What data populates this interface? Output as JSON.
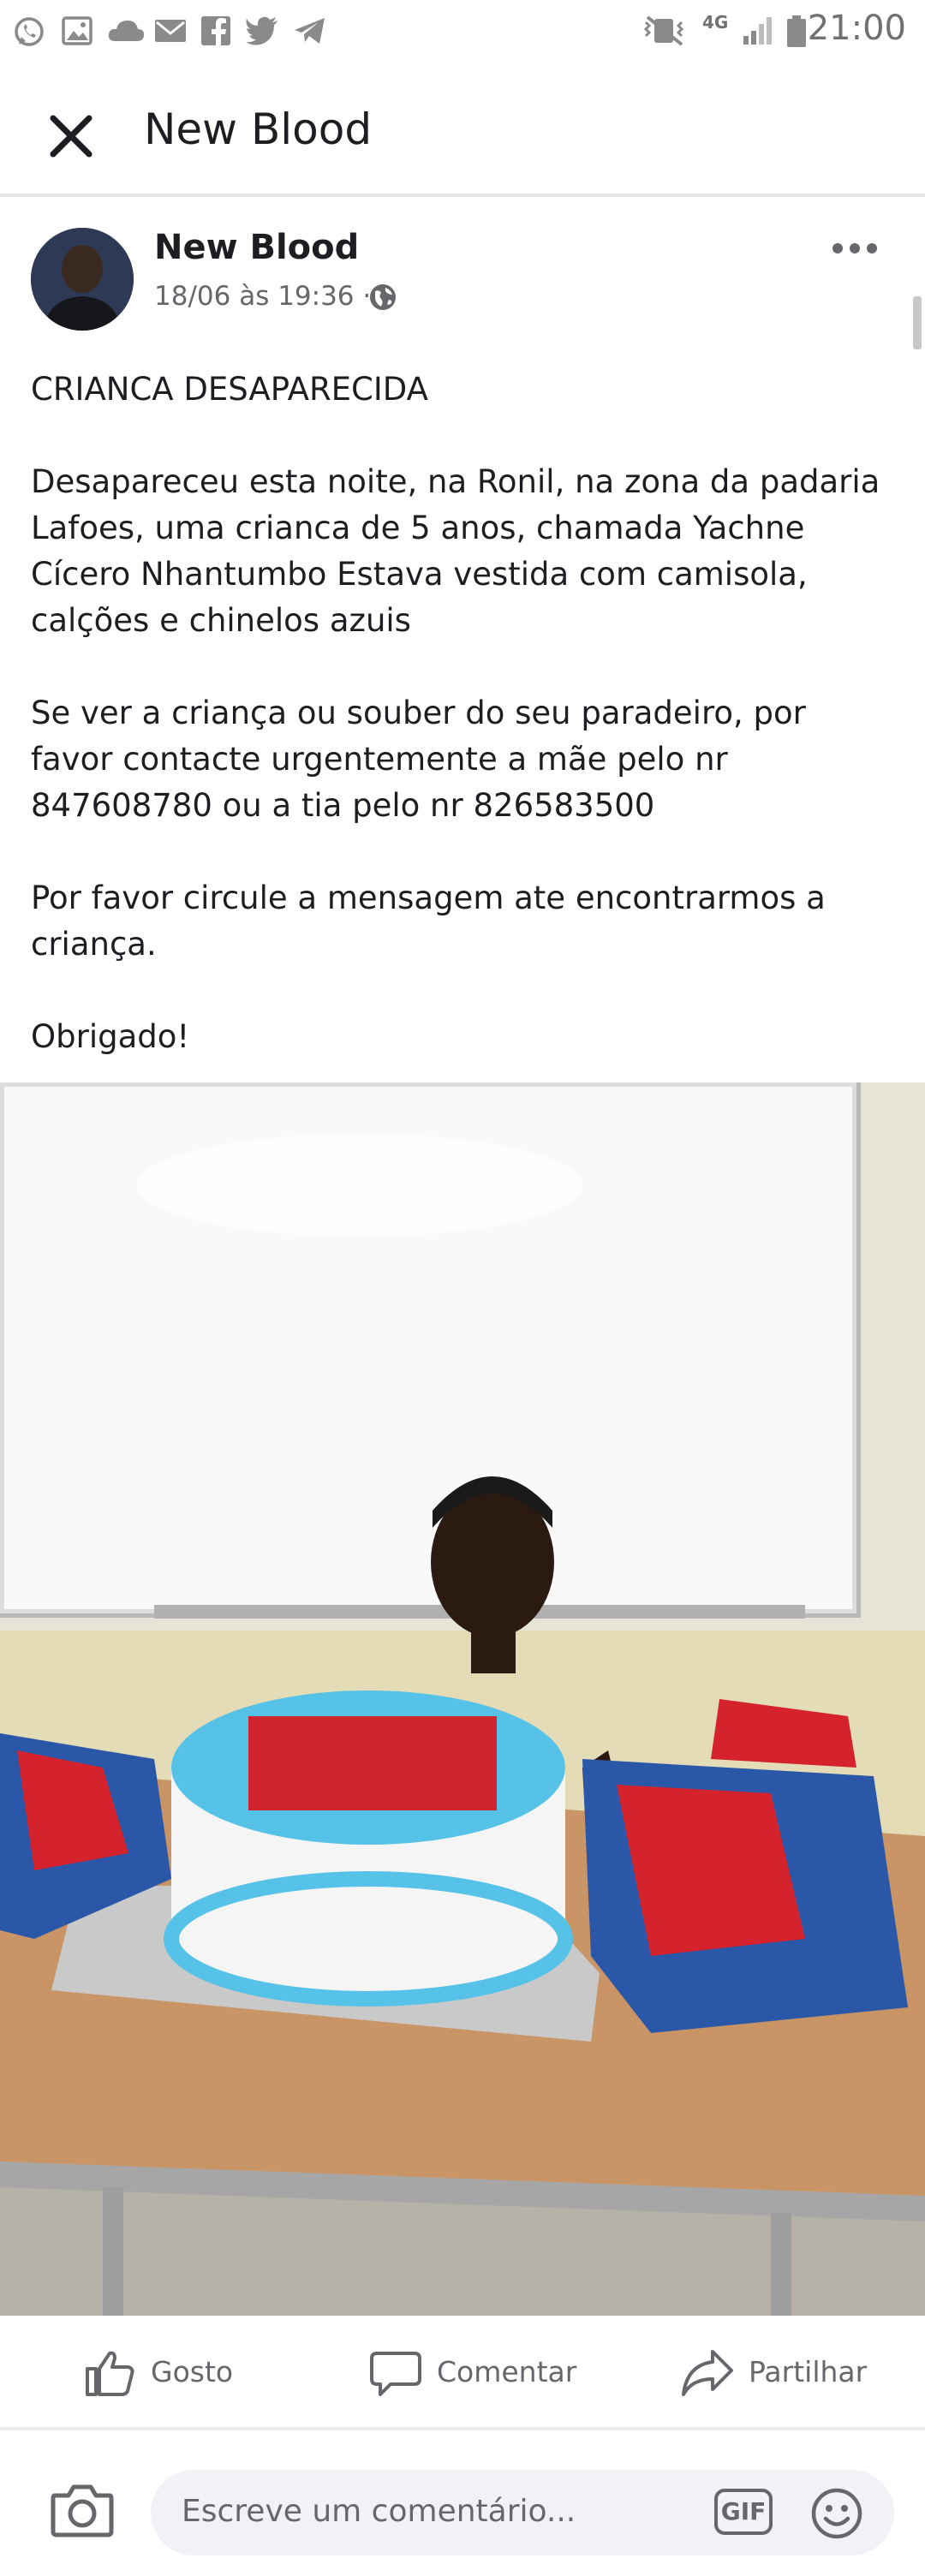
{
  "status_bar": {
    "time": "21:00",
    "network": "4G"
  },
  "header": {
    "title": "New Blood"
  },
  "post": {
    "author": "New Blood",
    "time": "18/06 às 19:36 ·",
    "paragraphs": [
      "CRIANCA DESAPARECIDA",
      "Desapareceu esta noite, na Ronil, na zona da padaria Lafoes, uma crianca de 5 anos, chamada Yachne Cícero Nhantumbo Estava vestida com camisola, calções e chinelos azuis",
      "Se ver a criança ou souber do seu paradeiro, por favor contacte urgentemente a mãe pelo nr 847608780 ou a tia pelo nr 826583500",
      "Por favor circule a mensagem ate encontrarmos a criança.",
      "Obrigado!"
    ]
  },
  "actions": {
    "like": "Gosto",
    "comment": "Comentar",
    "share": "Partilhar"
  },
  "comment_bar": {
    "placeholder": "Escreve um comentário...",
    "gif": "GIF"
  },
  "colors": {
    "text": "#1c1e21",
    "secondary": "#65676b",
    "divider": "#e4e6ea",
    "input_bg": "#f0f2f5"
  }
}
